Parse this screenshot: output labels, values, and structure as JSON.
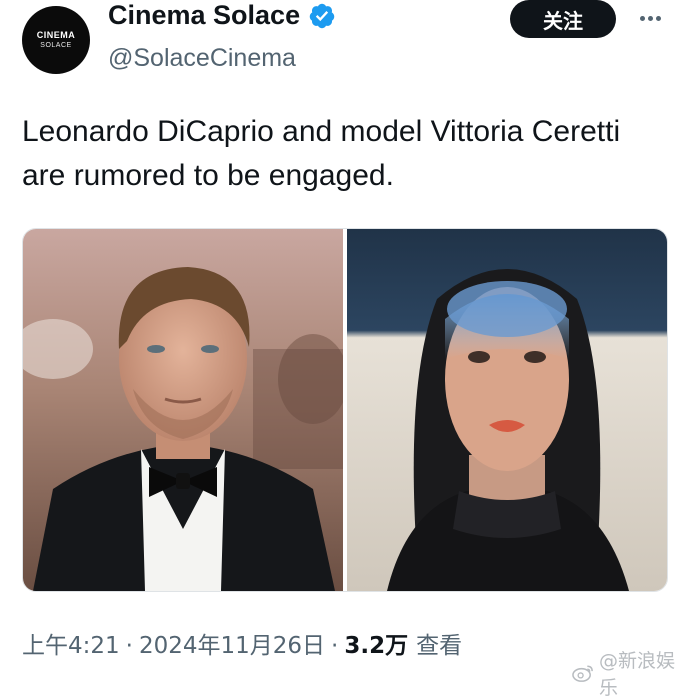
{
  "author": {
    "avatar_line1": "CINEMA",
    "avatar_line2": "SOLACE",
    "display_name": "Cinema Solace",
    "handle": "@SolaceCinema",
    "verified": true
  },
  "actions": {
    "follow_label": "关注",
    "more_icon": "more-dots-icon"
  },
  "tweet": {
    "text": "Leonardo DiCaprio and model Vittoria Ceretti are rumored to be engaged."
  },
  "media": {
    "photos": [
      {
        "subject": "man-in-tuxedo-portrait"
      },
      {
        "subject": "woman-with-blue-face-paint-portrait"
      }
    ]
  },
  "meta": {
    "time": "上午4:21",
    "date": "2024年11月26日",
    "separator": "·",
    "views_count": "3.2万",
    "views_label": "查看"
  },
  "watermark": {
    "text": "@新浪娱乐"
  },
  "colors": {
    "text": "#0f1419",
    "secondary": "#536471",
    "verified": "#1d9bf0",
    "follow_bg": "#0f1419"
  }
}
